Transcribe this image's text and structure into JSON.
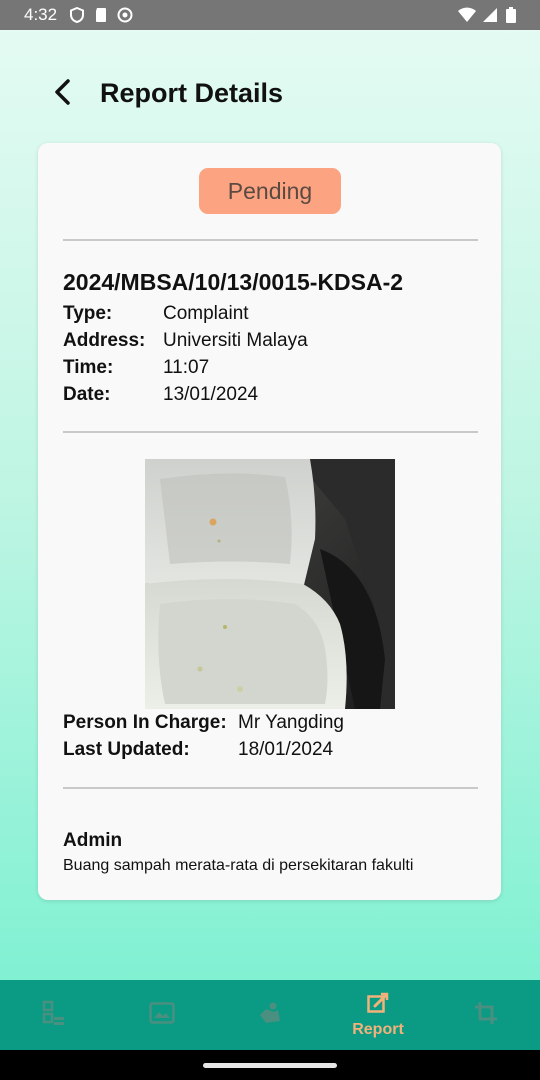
{
  "status_bar": {
    "time": "4:32",
    "left_icons": [
      "shield-icon",
      "sd-card-icon",
      "face-icon"
    ],
    "right_icons": [
      "wifi-icon",
      "signal-icon",
      "battery-icon"
    ]
  },
  "header": {
    "title": "Report Details"
  },
  "report": {
    "status": "Pending",
    "status_color": "#fca482",
    "id": "2024/MBSA/10/13/0015-KDSA-2",
    "fields": [
      {
        "label": "Type:",
        "value": "Complaint"
      },
      {
        "label": "Address:",
        "value": "Universiti Malaya"
      },
      {
        "label": "Time:",
        "value": "11:07"
      },
      {
        "label": "Date:",
        "value": "13/01/2024"
      }
    ],
    "meta": [
      {
        "label": "Person In Charge:",
        "value": "Mr Yangding"
      },
      {
        "label": "Last Updated:",
        "value": "18/01/2024"
      }
    ],
    "comment": {
      "author": "Admin",
      "text": "Buang sampah merata-rata di persekitaran fakulti"
    }
  },
  "bottom_nav": {
    "items": [
      {
        "icon": "checklist-icon",
        "label": ""
      },
      {
        "icon": "image-icon",
        "label": ""
      },
      {
        "icon": "people-icon",
        "label": ""
      },
      {
        "icon": "edit-square-icon",
        "label": "Report",
        "active": true
      },
      {
        "icon": "crop-icon",
        "label": ""
      }
    ],
    "background": "#0b9a84",
    "active_color": "#f3b27a",
    "inactive_color": "#4a8f7f"
  }
}
